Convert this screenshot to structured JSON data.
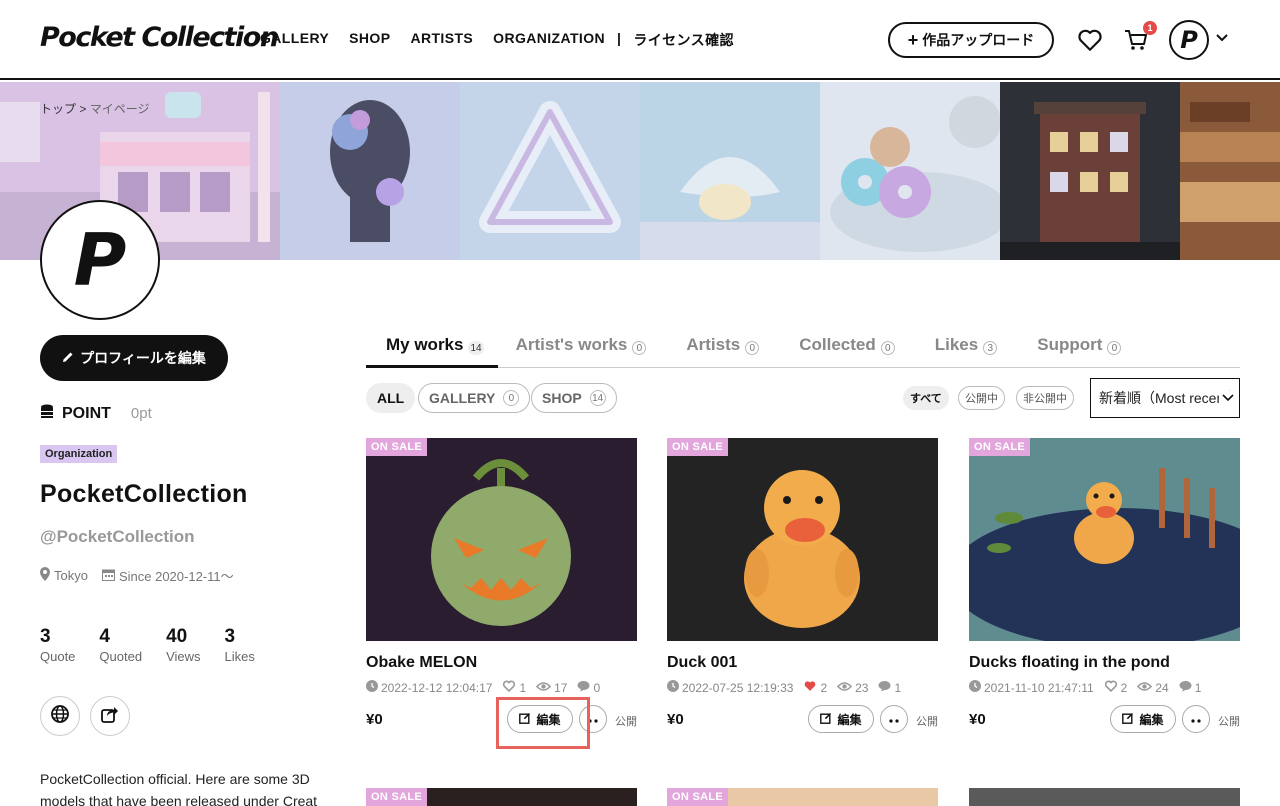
{
  "header": {
    "logo": "Pocket Collection",
    "nav": [
      "GALLERY",
      "SHOP",
      "ARTISTS",
      "ORGANIZATION",
      "ライセンス確認"
    ],
    "nav_separator": "|",
    "upload_label": "作品アップロード",
    "cart_count": "1",
    "avatar_letter": "P"
  },
  "breadcrumb": {
    "home": "トップ",
    "sep": ">",
    "current": "マイページ"
  },
  "profile": {
    "avatar_letter": "P",
    "edit_label": "プロフィールを編集",
    "point_label": "POINT",
    "point_value": "0pt",
    "badge": "Organization",
    "name": "PocketCollection",
    "handle": "@PocketCollection",
    "location": "Tokyo",
    "since": "Since 2020-12-11〜",
    "stats": [
      {
        "value": "3",
        "label": "Quote"
      },
      {
        "value": "4",
        "label": "Quoted"
      },
      {
        "value": "40",
        "label": "Views"
      },
      {
        "value": "3",
        "label": "Likes"
      }
    ],
    "bio": "PocketCollection official. Here are some 3D models that have been released under Creat"
  },
  "tabs": [
    {
      "label": "My works",
      "count": "14"
    },
    {
      "label": "Artist's works",
      "count": "0"
    },
    {
      "label": "Artists",
      "count": "0"
    },
    {
      "label": "Collected",
      "count": "0"
    },
    {
      "label": "Likes",
      "count": "3"
    },
    {
      "label": "Support",
      "count": "0"
    }
  ],
  "filters": {
    "chips": [
      {
        "label": "ALL",
        "count": ""
      },
      {
        "label": "GALLERY",
        "count": "0"
      },
      {
        "label": "SHOP",
        "count": "14"
      }
    ],
    "visibility": [
      "すべて",
      "公開中",
      "非公開中"
    ],
    "sort": "新着順（Most recent）"
  },
  "cards": [
    {
      "badge": "ON SALE",
      "title": "Obake MELON",
      "date": "2022-12-12 12:04:17",
      "likes": "1",
      "views": "17",
      "comments": "0",
      "price": "¥0",
      "edit_label": "編集",
      "status": "公開",
      "liked": false
    },
    {
      "badge": "ON SALE",
      "title": "Duck 001",
      "date": "2022-07-25 12:19:33",
      "likes": "2",
      "views": "23",
      "comments": "1",
      "price": "¥0",
      "edit_label": "編集",
      "status": "公開",
      "liked": true
    },
    {
      "badge": "ON SALE",
      "title": "Ducks floating in the pond",
      "date": "2021-11-10 21:47:11",
      "likes": "2",
      "views": "24",
      "comments": "1",
      "price": "¥0",
      "edit_label": "編集",
      "status": "公開",
      "liked": false
    }
  ],
  "next_row_badges": [
    "ON SALE",
    "ON SALE"
  ],
  "colors": {
    "accent": "#111111",
    "onsale": "#e2a6dd",
    "org_badge": "#d9c6f1",
    "highlight": "#e8625c",
    "liked": "#e54a4a"
  }
}
